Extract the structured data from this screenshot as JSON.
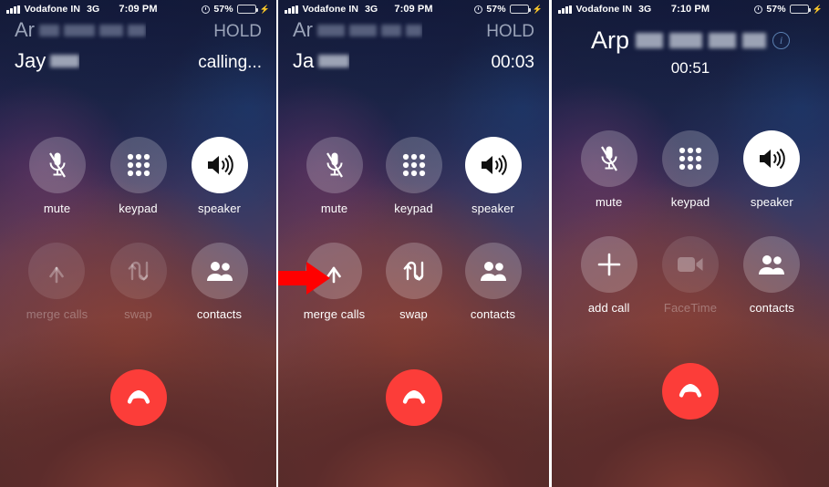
{
  "meta": {
    "accent_red": "#fc3d39",
    "battery_green": "#4cd964",
    "arrow_red": "#ff0000",
    "info_blue": "#5a7fb0"
  },
  "panels": [
    {
      "id": "panel-1",
      "status_bar": {
        "carrier": "Vodafone IN",
        "network": "3G",
        "time": "7:09 PM",
        "battery_percent": "57%",
        "battery_level": 57,
        "charging": true,
        "signal_bars": 4,
        "alarm_icon": "alarm-icon",
        "bolt_icon": "charging-bolt-icon"
      },
      "call": {
        "layout": "two-line",
        "held_name_prefix": "Ar",
        "held_status": "HOLD",
        "active_name_prefix": "Jay",
        "active_status": "calling..."
      },
      "buttons": [
        {
          "label": "mute",
          "icon": "microphone-mute-icon",
          "state": "enabled"
        },
        {
          "label": "keypad",
          "icon": "keypad-grid-icon",
          "state": "enabled"
        },
        {
          "label": "speaker",
          "icon": "speaker-icon",
          "state": "active"
        },
        {
          "label": "merge calls",
          "icon": "merge-calls-icon",
          "state": "disabled"
        },
        {
          "label": "swap",
          "icon": "swap-calls-icon",
          "state": "disabled"
        },
        {
          "label": "contacts",
          "icon": "contacts-icon",
          "state": "enabled"
        }
      ],
      "end_call": {
        "icon": "end-call-icon"
      },
      "annotation": null
    },
    {
      "id": "panel-2",
      "status_bar": {
        "carrier": "Vodafone IN",
        "network": "3G",
        "time": "7:09 PM",
        "battery_percent": "57%",
        "battery_level": 57,
        "charging": true,
        "signal_bars": 4,
        "alarm_icon": "alarm-icon",
        "bolt_icon": "charging-bolt-icon"
      },
      "call": {
        "layout": "two-line",
        "held_name_prefix": "Ar",
        "held_status": "HOLD",
        "active_name_prefix": "Ja",
        "active_status": "00:03"
      },
      "buttons": [
        {
          "label": "mute",
          "icon": "microphone-mute-icon",
          "state": "enabled"
        },
        {
          "label": "keypad",
          "icon": "keypad-grid-icon",
          "state": "enabled"
        },
        {
          "label": "speaker",
          "icon": "speaker-icon",
          "state": "active"
        },
        {
          "label": "merge calls",
          "icon": "merge-calls-icon",
          "state": "enabled"
        },
        {
          "label": "swap",
          "icon": "swap-calls-icon",
          "state": "enabled"
        },
        {
          "label": "contacts",
          "icon": "contacts-icon",
          "state": "enabled"
        }
      ],
      "end_call": {
        "icon": "end-call-icon"
      },
      "annotation": {
        "type": "arrow",
        "points_to": "merge calls",
        "color": "#ff0000"
      }
    },
    {
      "id": "panel-3",
      "status_bar": {
        "carrier": "Vodafone IN",
        "network": "3G",
        "time": "7:10 PM",
        "battery_percent": "57%",
        "battery_level": 57,
        "charging": true,
        "signal_bars": 4,
        "alarm_icon": "alarm-icon",
        "bolt_icon": "charging-bolt-icon"
      },
      "call": {
        "layout": "single-line",
        "name_prefix": "Arp",
        "timer": "00:51",
        "info_icon": "info-circle-icon"
      },
      "buttons": [
        {
          "label": "mute",
          "icon": "microphone-mute-icon",
          "state": "enabled"
        },
        {
          "label": "keypad",
          "icon": "keypad-grid-icon",
          "state": "enabled"
        },
        {
          "label": "speaker",
          "icon": "speaker-icon",
          "state": "active"
        },
        {
          "label": "add call",
          "icon": "add-call-plus-icon",
          "state": "enabled"
        },
        {
          "label": "FaceTime",
          "icon": "facetime-video-icon",
          "state": "disabled"
        },
        {
          "label": "contacts",
          "icon": "contacts-icon",
          "state": "enabled"
        }
      ],
      "end_call": {
        "icon": "end-call-icon"
      },
      "annotation": null
    }
  ]
}
